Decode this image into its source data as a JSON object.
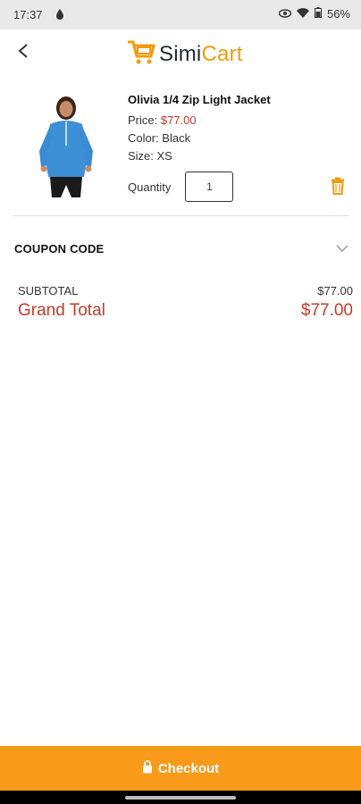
{
  "status_bar": {
    "time": "17:37",
    "battery": "56%"
  },
  "header": {
    "logo_simi": "Simi",
    "logo_cart": "Cart"
  },
  "cart_item": {
    "name": "Olivia 1/4 Zip Light Jacket",
    "price_label": "Price: ",
    "price_value": "$77.00",
    "color": "Color: Black",
    "size": "Size: XS",
    "quantity_label": "Quantity",
    "quantity_value": "1"
  },
  "coupon": {
    "label": "COUPON CODE"
  },
  "totals": {
    "subtotal_label": "SUBTOTAL",
    "subtotal_value": "$77.00",
    "grand_label": "Grand Total",
    "grand_value": "$77.00"
  },
  "checkout": {
    "label": "Checkout"
  },
  "colors": {
    "accent": "#f99a1a",
    "price": "#c43b2a",
    "trash": "#f59a0d"
  },
  "icons": [
    "back-arrow-icon",
    "trash-icon",
    "chevron-down-icon",
    "lock-icon",
    "wifi-icon",
    "battery-icon"
  ]
}
